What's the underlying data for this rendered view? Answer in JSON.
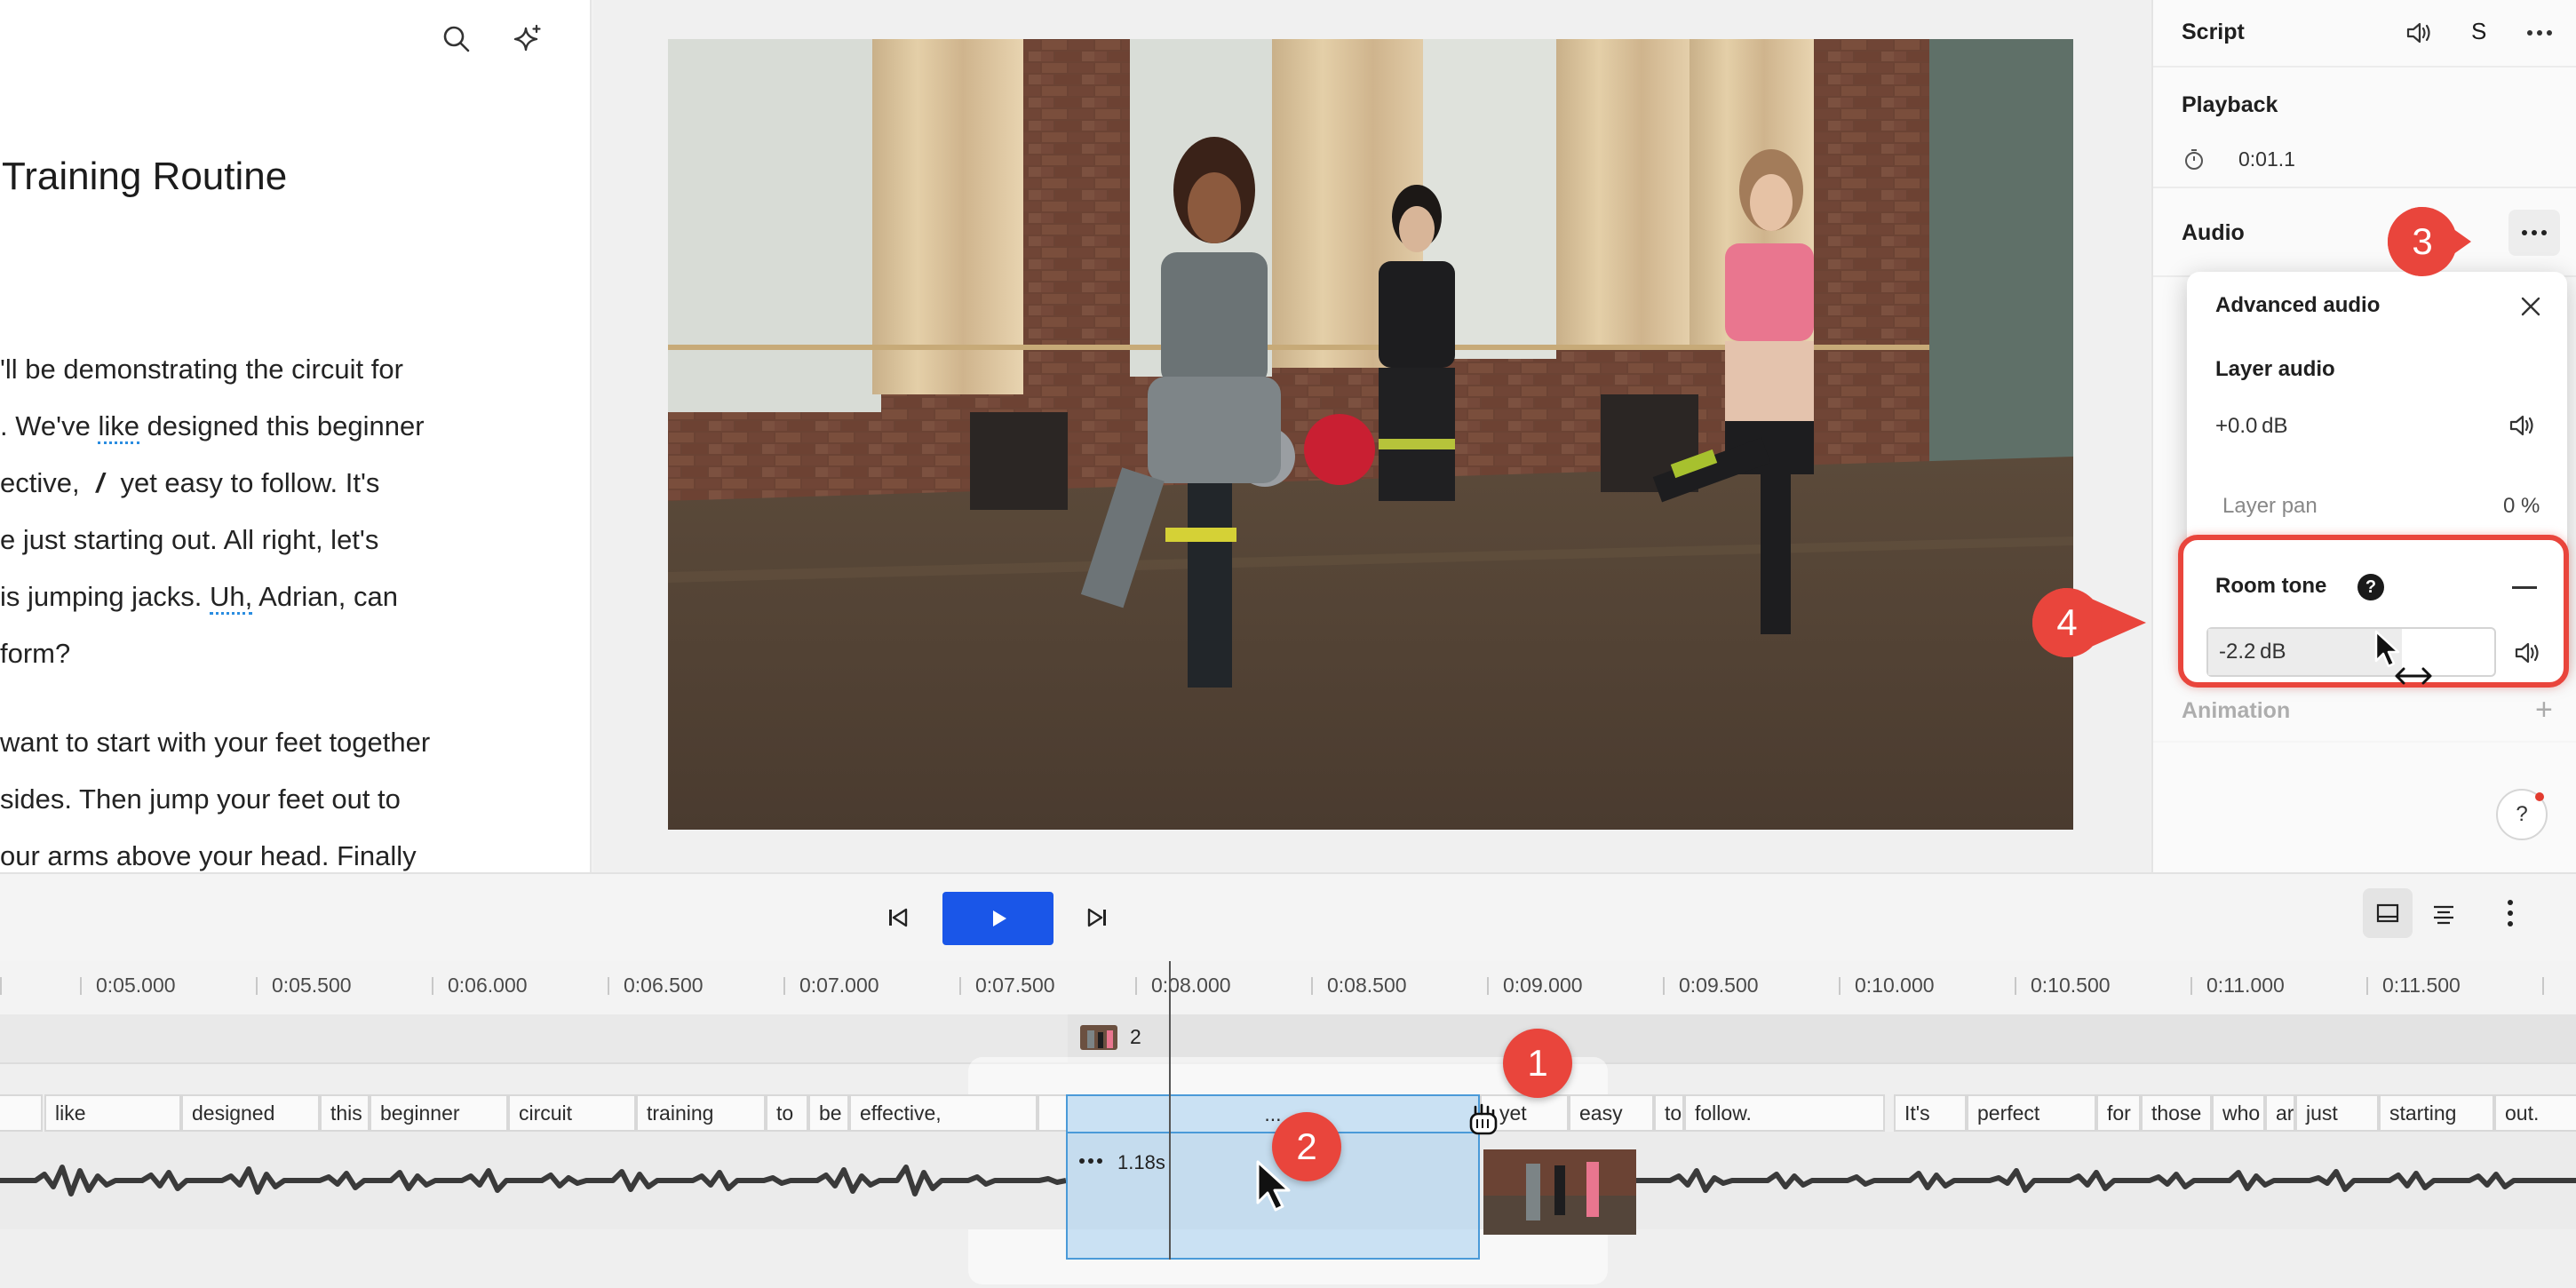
{
  "script": {
    "title": "Training Routine",
    "paragraph1": [
      "'ll be demonstrating the circuit for",
      ". We've ",
      "like",
      " designed this beginner",
      "ective, ",
      "/",
      " yet easy to follow. It's",
      "e just starting out. All right, let's",
      "is jumping jacks. ",
      "Uh,",
      " Adrian, can",
      " form?"
    ],
    "paragraph2": [
      "want to start with your feet together",
      "sides. Then jump your feet out to",
      "our arms above your head. Finally"
    ]
  },
  "properties": {
    "header": {
      "title": "Script",
      "s_label": "S"
    },
    "playback": {
      "label": "Playback",
      "time": "0:01.1"
    },
    "audio": {
      "label": "Audio"
    },
    "animation": {
      "label": "Animation"
    },
    "help": "?"
  },
  "popover": {
    "title": "Advanced audio",
    "layer_audio": {
      "label": "Layer audio",
      "value": "+0.0 dB"
    },
    "layer_pan": {
      "label": "Layer pan",
      "value": "0 %"
    },
    "room_tone": {
      "label": "Room tone",
      "help": "?",
      "value": "-2.2 dB"
    }
  },
  "callouts": [
    "1",
    "2",
    "3",
    "4"
  ],
  "timeline": {
    "ticks": [
      "0:05.000",
      "0:05.500",
      "0:06.000",
      "0:06.500",
      "0:07.000",
      "0:07.500",
      "0:08.000",
      "0:08.500",
      "0:09.000",
      "0:09.500",
      "0:10.000",
      "0:10.500",
      "0:11.000",
      "0:11.500"
    ],
    "scene_number": "2",
    "selection_label": "...",
    "gap_duration": "1.18s",
    "words": [
      "like",
      "designed",
      "this",
      "beginner",
      "circuit",
      "training",
      "to",
      "be",
      "effective,",
      "yet",
      "easy",
      "to",
      "follow.",
      "It's",
      "perfect",
      "for",
      "those",
      "who",
      "ar",
      "just",
      "starting",
      "out."
    ]
  },
  "colors": {
    "accent": "#1a56e8",
    "callout": "#e9453c",
    "selection": "#b0d4f0",
    "filler_underline": "#2a8de0"
  }
}
